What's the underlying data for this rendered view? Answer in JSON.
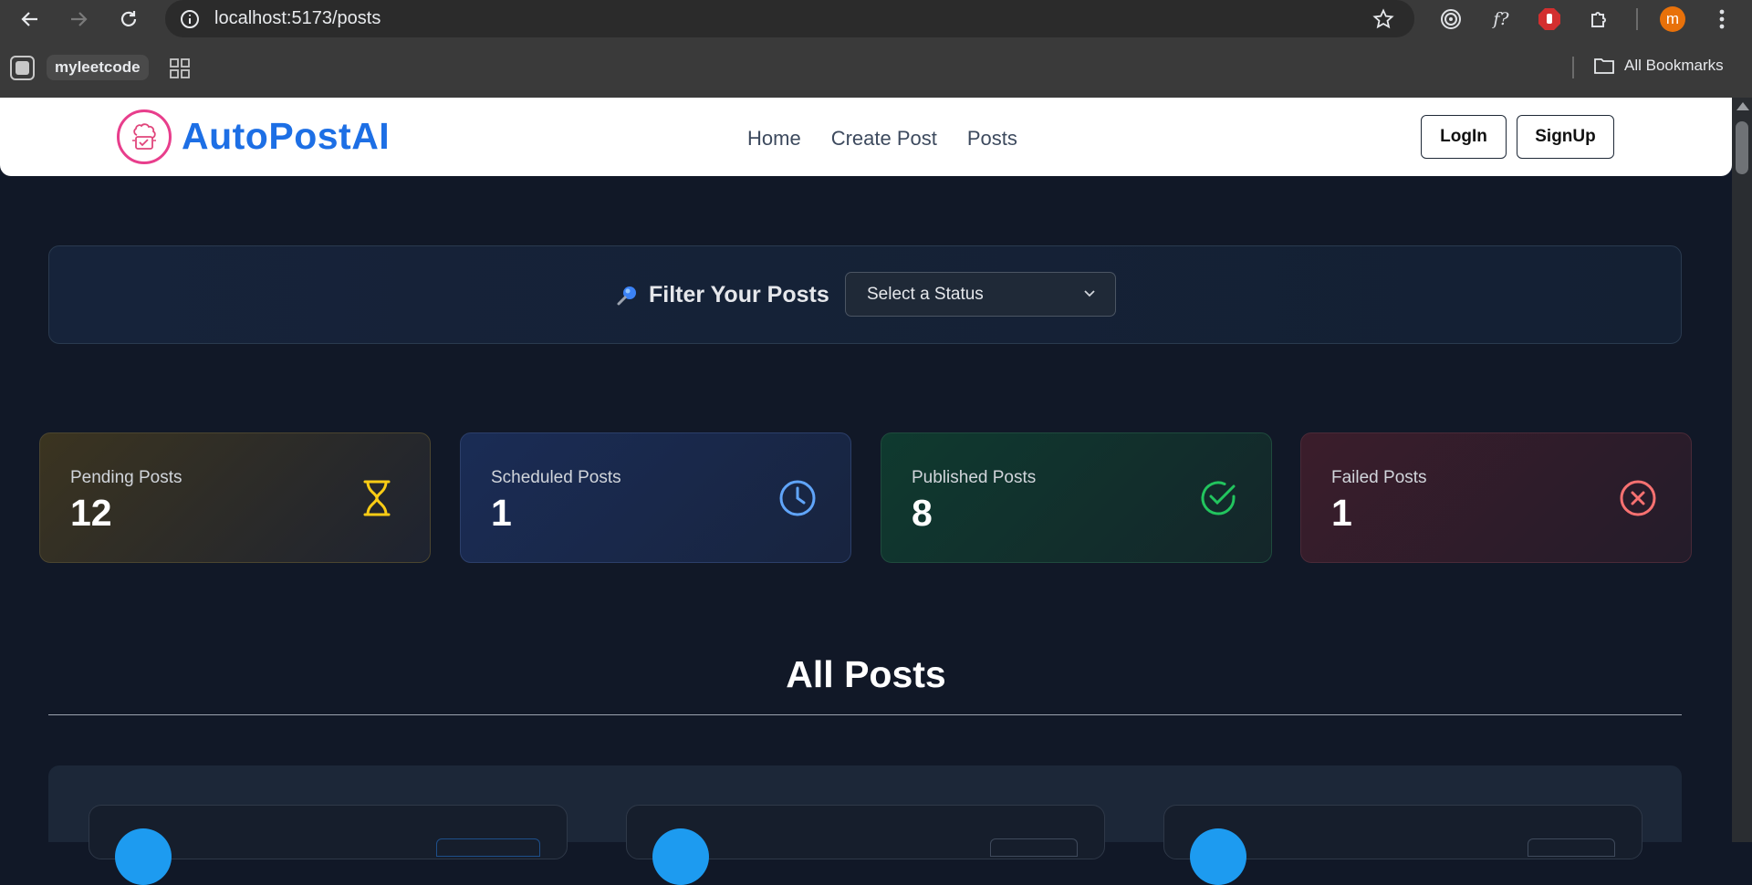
{
  "browser": {
    "url": "localhost:5173/posts",
    "bookmark_chip": "myleetcode",
    "all_bookmarks": "All Bookmarks",
    "profile_initial": "m",
    "ext_icons": [
      "radar-icon",
      "f-icon",
      "stop-hand-icon",
      "puzzle-icon"
    ]
  },
  "navbar": {
    "brand": "AutoPostAI",
    "links": [
      "Home",
      "Create Post",
      "Posts"
    ],
    "login": "LogIn",
    "signup": "SignUp"
  },
  "filter": {
    "title": "Filter Your Posts",
    "select_value": "Select a Status"
  },
  "stats": [
    {
      "label": "Pending Posts",
      "value": "12",
      "icon": "hourglass-icon",
      "color": "#facc15"
    },
    {
      "label": "Scheduled Posts",
      "value": "1",
      "icon": "clock-icon",
      "color": "#60a5fa"
    },
    {
      "label": "Published Posts",
      "value": "8",
      "icon": "check-circle-icon",
      "color": "#22c55e"
    },
    {
      "label": "Failed Posts",
      "value": "1",
      "icon": "x-circle-icon",
      "color": "#f87171"
    }
  ],
  "posts": {
    "title": "All Posts"
  }
}
